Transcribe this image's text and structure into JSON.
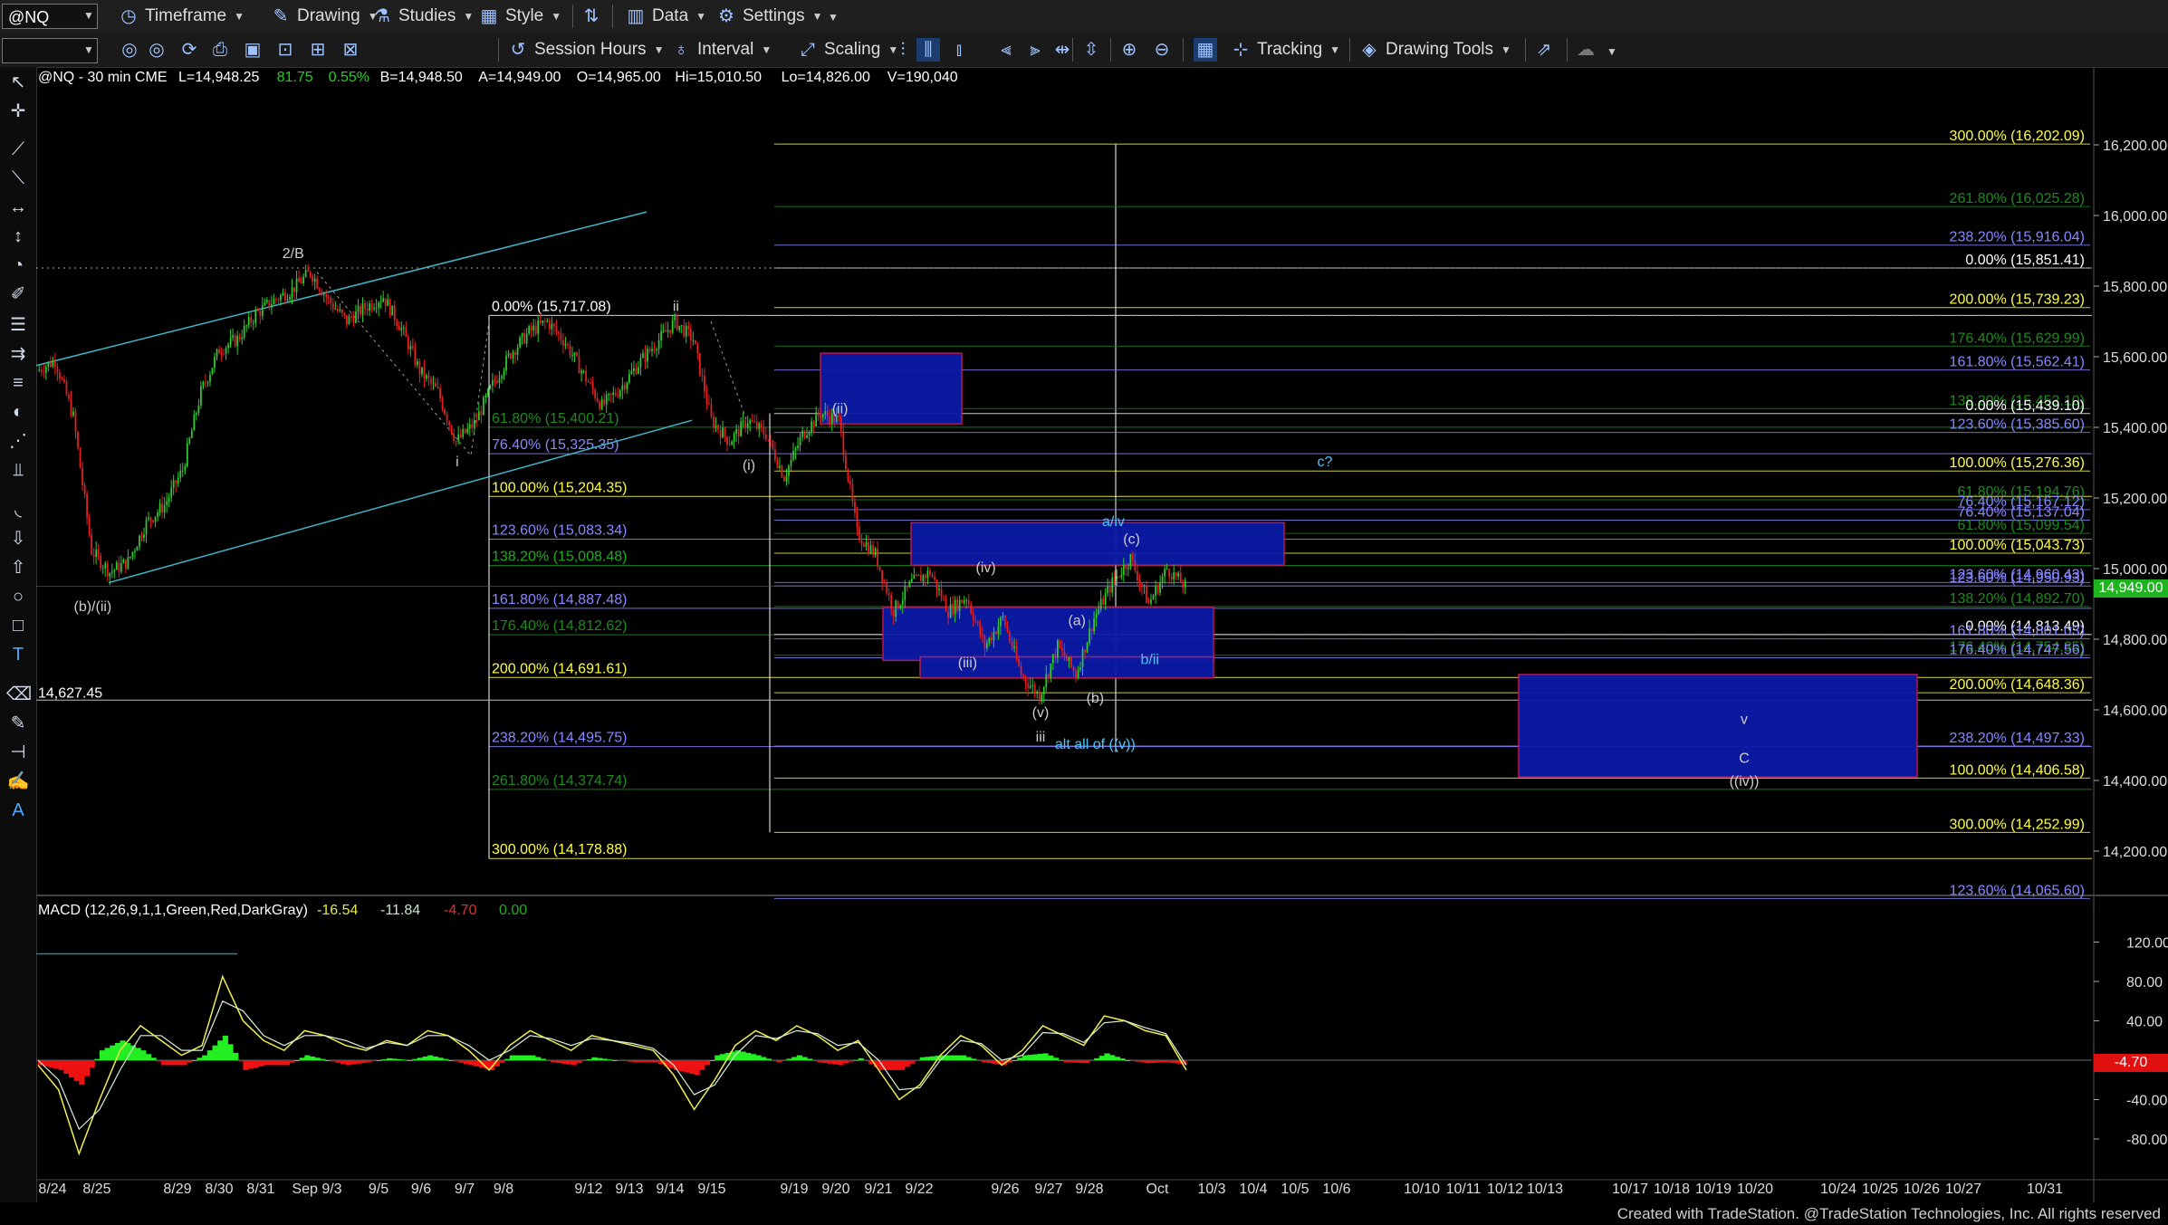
{
  "toolbar": {
    "symbol": "@NQ",
    "items": [
      {
        "label": "Timeframe",
        "icon": "clock-icon"
      },
      {
        "label": "Drawing",
        "icon": "pencil-icon"
      },
      {
        "label": "Studies",
        "icon": "flask-icon"
      },
      {
        "label": "Style",
        "icon": "style-icon"
      },
      {
        "label": "Data",
        "icon": "data-icon"
      },
      {
        "label": "Settings",
        "icon": "gear-icon"
      }
    ],
    "row2": [
      {
        "label": "Session Hours",
        "icon": "session-icon"
      },
      {
        "label": "Interval",
        "icon": "interval-icon"
      },
      {
        "label": "Scaling",
        "icon": "scaling-icon"
      },
      {
        "label": "Tracking",
        "icon": "grid-icon"
      },
      {
        "label": "Drawing Tools",
        "icon": "drawing-tools-icon"
      }
    ]
  },
  "chart_header": {
    "symbol_line": "@NQ - 30 min  CME",
    "fields": [
      {
        "text": "L=14,948.25",
        "color": "#ffffff"
      },
      {
        "text": "81.75",
        "color": "#1fd01f"
      },
      {
        "text": "0.55%",
        "color": "#1fd01f"
      },
      {
        "text": "B=14,948.50",
        "color": "#ffffff"
      },
      {
        "text": "A=14,949.00",
        "color": "#ffffff"
      },
      {
        "text": "O=14,965.00",
        "color": "#ffffff"
      },
      {
        "text": "Hi=15,010.50",
        "color": "#ffffff"
      },
      {
        "text": "Lo=14,826.00",
        "color": "#ffffff"
      },
      {
        "text": "V=190,040",
        "color": "#ffffff"
      }
    ]
  },
  "chart_data": [
    {
      "type": "candlestick",
      "title": "@NQ - 30 min",
      "ylim": [
        14000,
        16400
      ],
      "y_ticks": [
        "16,200.00",
        "16,000.00",
        "15,800.00",
        "15,600.00",
        "15,400.00",
        "15,200.00",
        "15,000.00",
        "14,800.00",
        "14,600.00",
        "14,400.00",
        "14,200.00"
      ],
      "last_price": "14,949.00",
      "x_ticks": [
        "8/24",
        "8/25",
        "8/29",
        "8/30",
        "8/31",
        "Sep 9/3",
        "9/5",
        "9/6",
        "9/7",
        "9/8",
        "9/12",
        "9/13",
        "9/14",
        "9/15",
        "9/19",
        "9/20",
        "9/21",
        "9/22",
        "9/26",
        "9/27",
        "9/28",
        "Oct",
        "10/3",
        "10/4",
        "10/5",
        "10/6",
        "10/10",
        "10/11",
        "10/12",
        "10/13",
        "10/17",
        "10/18",
        "10/19",
        "10/20",
        "10/24",
        "10/25",
        "10/26",
        "10/27",
        "10/31"
      ],
      "price_path": [
        [
          "8/24",
          15560
        ],
        [
          "8/24b",
          15590
        ],
        [
          "8/24c",
          15430
        ],
        [
          "8/25",
          15050
        ],
        [
          "8/25b",
          14990
        ],
        [
          "8/25c",
          15020
        ],
        [
          "8/26",
          15130
        ],
        [
          "8/26b",
          15180
        ],
        [
          "8/29",
          15280
        ],
        [
          "8/29b",
          15500
        ],
        [
          "8/30",
          15620
        ],
        [
          "8/30b",
          15650
        ],
        [
          "8/31",
          15720
        ],
        [
          "8/31b",
          15760
        ],
        [
          "9/1",
          15790
        ],
        [
          "9/1b",
          15840
        ],
        [
          "9/2",
          15760
        ],
        [
          "9/2b",
          15700
        ],
        [
          "9/5",
          15740
        ],
        [
          "9/5b",
          15770
        ],
        [
          "9/6",
          15680
        ],
        [
          "9/6b",
          15560
        ],
        [
          "9/7",
          15500
        ],
        [
          "9/7b",
          15360
        ],
        [
          "9/8",
          15410
        ],
        [
          "9/8b",
          15520
        ],
        [
          "9/9",
          15610
        ],
        [
          "9/9b",
          15670
        ],
        [
          "9/12",
          15700
        ],
        [
          "9/12b",
          15640
        ],
        [
          "9/13",
          15550
        ],
        [
          "9/13b",
          15460
        ],
        [
          "9/13c",
          15510
        ],
        [
          "9/14",
          15580
        ],
        [
          "9/14b",
          15640
        ],
        [
          "9/15",
          15700
        ],
        [
          "9/15b",
          15650
        ],
        [
          "9/16",
          15420
        ],
        [
          "9/16b",
          15360
        ],
        [
          "9/19",
          15420
        ],
        [
          "9/19b",
          15380
        ],
        [
          "9/19c",
          15260
        ],
        [
          "9/20",
          15380
        ],
        [
          "9/20b",
          15440
        ],
        [
          "9/20c",
          15420
        ],
        [
          "9/21",
          15100
        ],
        [
          "9/21b",
          15040
        ],
        [
          "9/22",
          14880
        ],
        [
          "9/22b",
          14960
        ],
        [
          "9/23",
          14990
        ],
        [
          "9/23b",
          14880
        ],
        [
          "9/26",
          14920
        ],
        [
          "9/26b",
          14780
        ],
        [
          "9/27",
          14860
        ],
        [
          "9/27b",
          14700
        ],
        [
          "9/28",
          14640
        ],
        [
          "9/28b",
          14780
        ],
        [
          "9/29",
          14700
        ],
        [
          "9/29b",
          14860
        ],
        [
          "9/30",
          14960
        ],
        [
          "9/30b",
          15030
        ],
        [
          "Oct",
          14900
        ],
        [
          "Oct-b",
          15000
        ],
        [
          "10/3",
          14949
        ]
      ],
      "fib_levels_left": [
        {
          "label": "0.00% (15,717.08)",
          "price": 15717.08,
          "color": "#ffffff"
        },
        {
          "label": "61.80% (15,400.21)",
          "price": 15400.21,
          "color": "#1e8a1e"
        },
        {
          "label": "76.40% (15,325.35)",
          "price": 15325.35,
          "color": "#8888ff"
        },
        {
          "label": "100.00% (15,204.35)",
          "price": 15204.35,
          "color": "#ffff44"
        },
        {
          "label": "123.60% (15,083.34)",
          "price": 15083.34,
          "color": "#8888ff"
        },
        {
          "label": "138.20% (15,008.48)",
          "price": 15008.48,
          "color": "#22aa22"
        },
        {
          "label": "161.80% (14,887.48)",
          "price": 14887.48,
          "color": "#8888ff"
        },
        {
          "label": "176.40% (14,812.62)",
          "price": 14812.62,
          "color": "#1e8a1e"
        },
        {
          "label": "200.00% (14,691.61)",
          "price": 14691.61,
          "color": "#ffff44"
        },
        {
          "label": "238.20% (14,495.75)",
          "price": 14495.75,
          "color": "#8888ff"
        },
        {
          "label": "261.80% (14,374.74)",
          "price": 14374.74,
          "color": "#1e8a1e"
        },
        {
          "label": "300.00% (14,178.88)",
          "price": 14178.88,
          "color": "#ffff44"
        }
      ],
      "fib_levels_right": [
        {
          "label": "300.00% (16,202.09)",
          "price": 16202.09,
          "color": "#ffff44"
        },
        {
          "label": "261.80% (16,025.28)",
          "price": 16025.28,
          "color": "#1e8a1e"
        },
        {
          "label": "238.20% (15,916.04)",
          "price": 15916.04,
          "color": "#8888ff"
        },
        {
          "label": "0.00% (15,851.41)",
          "price": 15851.41,
          "color": "#ffffff"
        },
        {
          "label": "200.00% (15,739.23)",
          "price": 15739.23,
          "color": "#ffff44"
        },
        {
          "label": "176.40% (15,629.99)",
          "price": 15629.99,
          "color": "#1e8a1e"
        },
        {
          "label": "161.80% (15,562.41)",
          "price": 15562.41,
          "color": "#8888ff"
        },
        {
          "label": "138.20% (15,453.10)",
          "price": 15453.1,
          "color": "#1e8a1e"
        },
        {
          "label": "0.00% (15,439.10)",
          "price": 15439.1,
          "color": "#ffffff"
        },
        {
          "label": "123.60% (15,385.60)",
          "price": 15385.6,
          "color": "#8888ff"
        },
        {
          "label": "100.00% (15,276.36)",
          "price": 15276.36,
          "color": "#ffff44"
        },
        {
          "label": "61.80% (15,194.76)",
          "price": 15194.76,
          "color": "#1e8a1e"
        },
        {
          "label": "76.40% (15,167.12)",
          "price": 15167.12,
          "color": "#8888ff"
        },
        {
          "label": "76.40% (15,137.04)",
          "price": 15137.04,
          "color": "#8888ff"
        },
        {
          "label": "61.80% (15,099.54)",
          "price": 15099.54,
          "color": "#1e8a1e"
        },
        {
          "label": "100.00% (15,043.73)",
          "price": 15043.73,
          "color": "#ffff44"
        },
        {
          "label": "123.60% (14,960.43)",
          "price": 14960.43,
          "color": "#8888ff"
        },
        {
          "label": "123.60% (14,950.93)",
          "price": 14950.93,
          "color": "#8888ff"
        },
        {
          "label": "138.20% (14,892.70)",
          "price": 14892.7,
          "color": "#1e8a1e"
        },
        {
          "label": "0.00% (14,813.49)",
          "price": 14813.49,
          "color": "#ffffff"
        },
        {
          "label": "161.80% (14,801.03)",
          "price": 14801.03,
          "color": "#8888ff"
        },
        {
          "label": "176.40% (14,754.85)",
          "price": 14754.85,
          "color": "#1e8a1e"
        },
        {
          "label": "176.40% (14,747.56)",
          "price": 14747.56,
          "color": "#8888ff"
        },
        {
          "label": "200.00% (14,648.36)",
          "price": 14648.36,
          "color": "#ffff44"
        },
        {
          "label": "238.20% (14,497.33)",
          "price": 14497.33,
          "color": "#8888ff"
        },
        {
          "label": "100.00% (14,406.58)",
          "price": 14406.58,
          "color": "#ffff44"
        },
        {
          "label": "300.00% (14,252.99)",
          "price": 14252.99,
          "color": "#ffff44"
        },
        {
          "label": "123.60% (14,065.60)",
          "price": 14065.6,
          "color": "#8888ff"
        }
      ],
      "horizontal_line": {
        "label": "14,627.45",
        "price": 14627.45
      },
      "wave_labels": [
        {
          "text": "2/B",
          "date": "9/1",
          "price": 15880,
          "color": "#cccccc"
        },
        {
          "text": "(b)/(ii)",
          "date": "8/25",
          "price": 14880,
          "color": "#cccccc"
        },
        {
          "text": "i",
          "date": "9/7b",
          "price": 15290,
          "color": "#cccccc"
        },
        {
          "text": "ii",
          "date": "9/15",
          "price": 15730,
          "color": "#cccccc"
        },
        {
          "text": "(i)",
          "date": "9/19",
          "price": 15280,
          "color": "#cccccc"
        },
        {
          "text": "(ii)",
          "date": "9/20c",
          "price": 15440,
          "color": "#cccccc"
        },
        {
          "text": "(iii)",
          "date": "9/26",
          "price": 14720,
          "color": "#cccccc"
        },
        {
          "text": "(iv)",
          "date": "9/26b",
          "price": 14990,
          "color": "#cccccc"
        },
        {
          "text": "(v)",
          "date": "9/28",
          "price": 14580,
          "color": "#cccccc"
        },
        {
          "text": "iii",
          "date": "9/28",
          "price": 14510,
          "color": "#cccccc"
        },
        {
          "text": "(a)",
          "date": "9/29",
          "price": 14840,
          "color": "#cccccc"
        },
        {
          "text": "(b)",
          "date": "9/29b",
          "price": 14620,
          "color": "#cccccc"
        },
        {
          "text": "(c)",
          "date": "9/30b",
          "price": 15070,
          "color": "#cccccc"
        },
        {
          "text": "a/iv",
          "date": "9/30",
          "price": 15120,
          "color": "#4fc3f7"
        },
        {
          "text": "b/ii",
          "date": "Oct",
          "price": 14730,
          "color": "#4fc3f7"
        },
        {
          "text": "alt all of ((v))",
          "date": "9/29b",
          "price": 14490,
          "color": "#4fc3f7"
        },
        {
          "text": "c?",
          "date": "10/5",
          "price": 15290,
          "color": "#4fc3f7"
        },
        {
          "text": "v",
          "date": "10/19",
          "price": 14560,
          "color": "#cccccc"
        },
        {
          "text": "C",
          "date": "10/19",
          "price": 14450,
          "color": "#cccccc"
        },
        {
          "text": "((iv))",
          "date": "10/19",
          "price": 14385,
          "color": "#cccccc"
        }
      ]
    },
    {
      "type": "line",
      "title": "MACD (12,26,9,1,1,Green,Red,DarkGray)",
      "ylim": [
        -100,
        140
      ],
      "y_ticks": [
        "120.00",
        "80.00",
        "40.00",
        "0.00",
        "-40.00",
        "-80.00"
      ],
      "header_values": [
        {
          "text": "-16.54",
          "color": "#e6e648"
        },
        {
          "text": "-11.84",
          "color": "#c8e6c8"
        },
        {
          "text": "-4.70",
          "color": "#e03030"
        },
        {
          "text": "0.00",
          "color": "#22aa22"
        }
      ],
      "last_value": "-4.70",
      "series": [
        {
          "name": "MACD",
          "values": [
            -5,
            -30,
            -95,
            -40,
            10,
            35,
            20,
            5,
            15,
            85,
            40,
            20,
            10,
            30,
            25,
            15,
            10,
            20,
            15,
            30,
            25,
            10,
            -10,
            15,
            30,
            20,
            10,
            25,
            20,
            15,
            10,
            -15,
            -50,
            -20,
            15,
            30,
            20,
            35,
            25,
            10,
            20,
            -10,
            -40,
            -25,
            5,
            25,
            15,
            -5,
            10,
            35,
            25,
            15,
            45,
            40,
            30,
            25,
            -10
          ]
        },
        {
          "name": "Signal",
          "values": [
            0,
            -20,
            -70,
            -50,
            -10,
            25,
            25,
            10,
            10,
            60,
            50,
            25,
            15,
            25,
            25,
            20,
            12,
            18,
            15,
            25,
            25,
            15,
            0,
            10,
            25,
            22,
            15,
            22,
            20,
            17,
            12,
            -5,
            -35,
            -25,
            5,
            25,
            22,
            30,
            27,
            15,
            18,
            0,
            -30,
            -28,
            0,
            20,
            17,
            0,
            5,
            28,
            27,
            18,
            38,
            40,
            33,
            27,
            -5
          ]
        }
      ]
    }
  ],
  "footer": {
    "credit": "Created with TradeStation. @TradeStation Technologies, Inc. All rights reserved"
  }
}
